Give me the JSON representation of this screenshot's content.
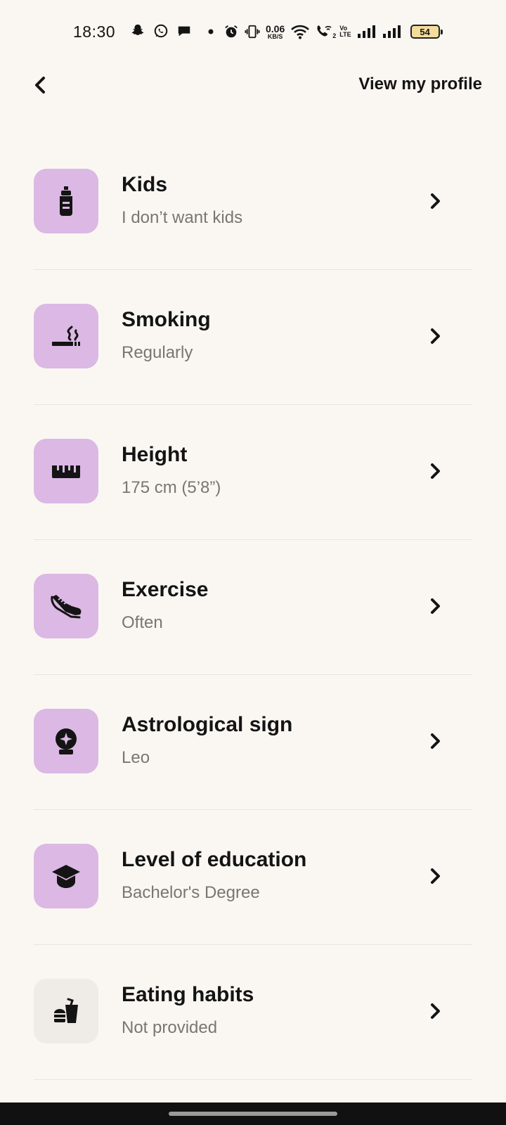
{
  "status_bar": {
    "time": "18:30",
    "net_speed_value": "0.06",
    "net_speed_unit": "KB/S",
    "volte_top": "Vo",
    "volte_bottom": "LTE",
    "sim_badge": "2",
    "battery": "54",
    "icons": [
      "snapchat-icon",
      "whatsapp-icon",
      "message-icon",
      "dot-icon",
      "alarm-icon",
      "vibrate-icon",
      "wifi-icon",
      "wifi-call-icon",
      "signal-icon",
      "signal-icon"
    ]
  },
  "header": {
    "back_icon": "chevron-left-icon",
    "view_profile_label": "View my profile"
  },
  "colors": {
    "background": "#faf7f2",
    "icon_tile_filled": "#dcb8e4",
    "icon_tile_empty": "#efebe6",
    "secondary_text": "#7a7572"
  },
  "items": [
    {
      "title": "Kids",
      "value": "I don’t want kids",
      "icon": "baby-bottle-icon"
    },
    {
      "title": "Smoking",
      "value": "Regularly",
      "icon": "cigarette-icon"
    },
    {
      "title": "Height",
      "value": "175 cm (5’8”)",
      "icon": "ruler-icon"
    },
    {
      "title": "Exercise",
      "value": "Often",
      "icon": "sneaker-icon"
    },
    {
      "title": "Astrological sign",
      "value": "Leo",
      "icon": "crystal-ball-icon"
    },
    {
      "title": "Level of education",
      "value": "Bachelor's Degree",
      "icon": "graduation-cap-icon"
    },
    {
      "title": "Eating habits",
      "value": "Not provided",
      "icon": "fast-food-icon"
    }
  ]
}
